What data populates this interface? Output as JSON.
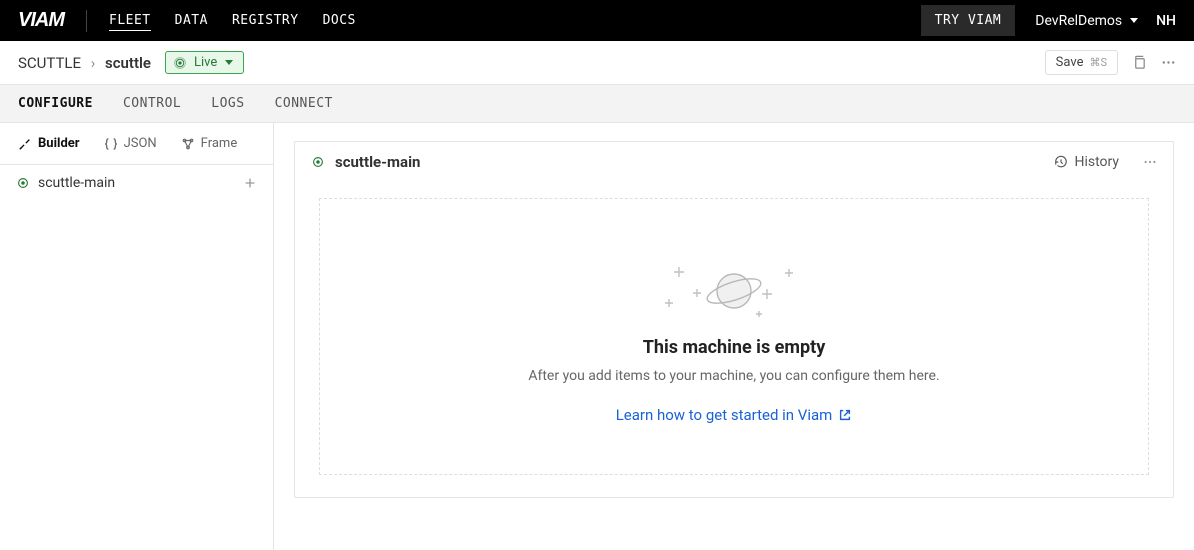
{
  "header": {
    "logo": "VIAM",
    "nav": [
      "FLEET",
      "DATA",
      "REGISTRY",
      "DOCS"
    ],
    "active_nav": "FLEET",
    "try_label": "TRY VIAM",
    "org_name": "DevRelDemos",
    "user_initials": "NH"
  },
  "breadcrumb": {
    "parent": "SCUTTLE",
    "current": "scuttle",
    "status_label": "Live",
    "save_label": "Save",
    "save_shortcut": "⌘S"
  },
  "tabs": {
    "items": [
      "CONFIGURE",
      "CONTROL",
      "LOGS",
      "CONNECT"
    ],
    "active": "CONFIGURE"
  },
  "views": {
    "items": [
      "Builder",
      "JSON",
      "Frame"
    ],
    "active": "Builder"
  },
  "sidebar": {
    "item_label": "scuttle-main"
  },
  "card": {
    "title": "scuttle-main",
    "history_label": "History"
  },
  "empty": {
    "title": "This machine is empty",
    "subtitle": "After you add items to your machine, you can configure them here.",
    "link_text": "Learn how to get started in Viam"
  }
}
